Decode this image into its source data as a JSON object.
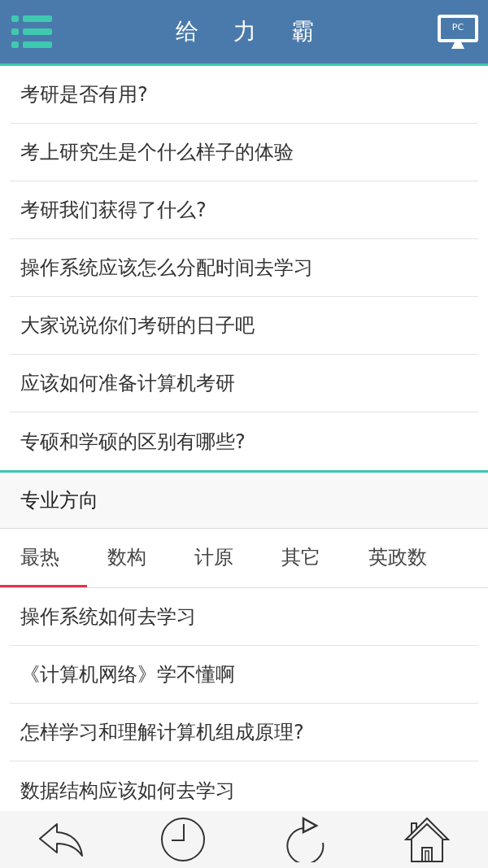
{
  "header": {
    "title": "给 力 霸",
    "pc_label": "PC"
  },
  "topics": [
    "考研是否有用?",
    "考上研究生是个什么样子的体验",
    "考研我们获得了什么?",
    "操作系统应该怎么分配时间去学习",
    "大家说说你们考研的日子吧",
    "应该如何准备计算机考研",
    "专硕和学硕的区别有哪些?"
  ],
  "section": {
    "title": "专业方向"
  },
  "tabs": [
    {
      "label": "最热",
      "selected": true
    },
    {
      "label": "数构",
      "selected": false
    },
    {
      "label": "计原",
      "selected": false
    },
    {
      "label": "其它",
      "selected": false
    },
    {
      "label": "英政数",
      "selected": false
    }
  ],
  "tab_items": [
    "操作系统如何去学习",
    "《计算机网络》学不懂啊",
    "怎样学习和理解计算机组成原理?",
    "数据结构应该如何去学习"
  ],
  "bottom_nav": [
    {
      "kind": "back"
    },
    {
      "kind": "clock"
    },
    {
      "kind": "refresh"
    },
    {
      "kind": "home"
    }
  ]
}
